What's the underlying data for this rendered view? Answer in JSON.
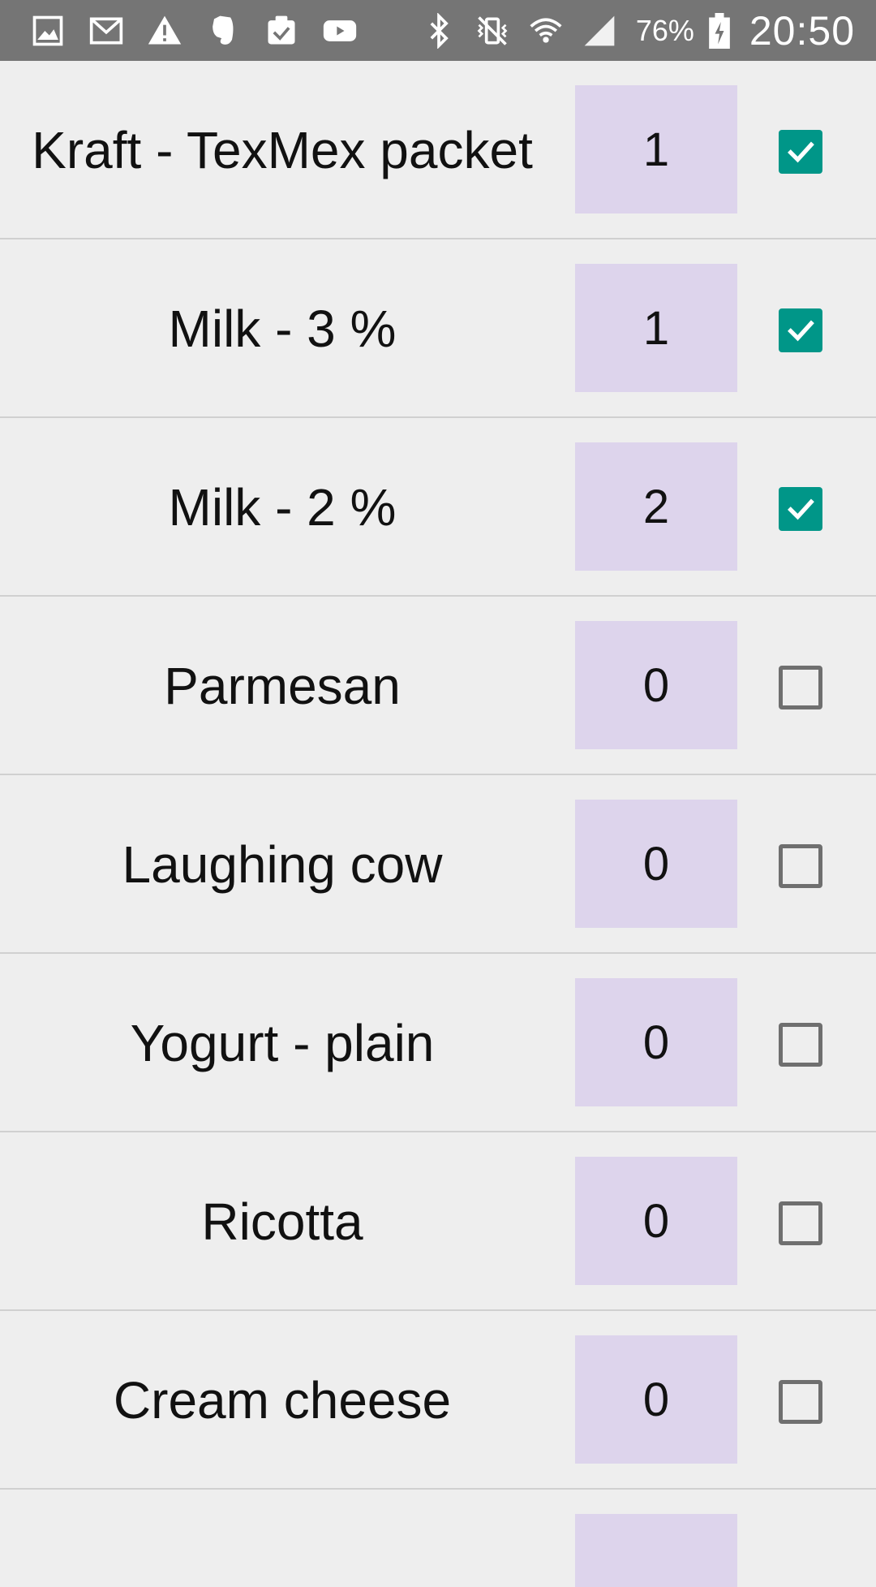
{
  "status_bar": {
    "icons_left": [
      "gallery-icon",
      "gmail-icon",
      "warning-icon",
      "evernote-icon",
      "clipboard-check-icon",
      "youtube-icon"
    ],
    "icons_right": [
      "bluetooth-icon",
      "vibrate-mute-icon",
      "wifi-icon",
      "signal-icon",
      "battery-charging-icon"
    ],
    "battery": "76%",
    "time": "20:50"
  },
  "items": [
    {
      "name": "Kraft - TexMex packet",
      "qty": "1",
      "checked": true
    },
    {
      "name": "Milk - 3 %",
      "qty": "1",
      "checked": true
    },
    {
      "name": "Milk - 2 %",
      "qty": "2",
      "checked": true
    },
    {
      "name": "Parmesan",
      "qty": "0",
      "checked": false
    },
    {
      "name": "Laughing cow",
      "qty": "0",
      "checked": false
    },
    {
      "name": "Yogurt - plain",
      "qty": "0",
      "checked": false
    },
    {
      "name": "Ricotta",
      "qty": "0",
      "checked": false
    },
    {
      "name": "Cream cheese",
      "qty": "0",
      "checked": false
    }
  ],
  "colors": {
    "status_bar": "#757575",
    "background": "#eeeeee",
    "qty_box": "#ddd4ec",
    "checkbox_checked": "#009688",
    "checkbox_unchecked_border": "#6f6f6f",
    "divider": "#d0d0d0"
  }
}
